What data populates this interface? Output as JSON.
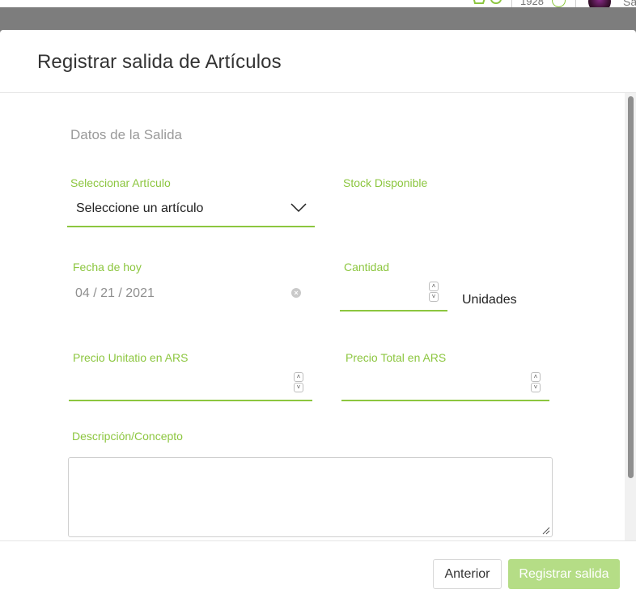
{
  "topbar": {
    "points": "1928",
    "user_name_partial": "Sa",
    "icons": [
      "cart-icon",
      "notification-icon",
      "coin-icon",
      "avatar"
    ]
  },
  "modal": {
    "title": "Registrar salida de Artículos",
    "section_title": "Datos de la Salida",
    "fields": {
      "article": {
        "label": "Seleccionar Artículo",
        "value": "Seleccione un artículo"
      },
      "stock": {
        "label": "Stock Disponible",
        "value": ""
      },
      "date": {
        "label": "Fecha de hoy",
        "value": "04 / 21 / 2021"
      },
      "quantity": {
        "label": "Cantidad",
        "value": "",
        "unit": "Unidades"
      },
      "unit_price": {
        "label": "Precio Unitatio en ARS",
        "value": ""
      },
      "total_price": {
        "label": "Precio Total en ARS",
        "value": ""
      },
      "description": {
        "label": "Descripción/Concepto",
        "value": ""
      }
    },
    "footer": {
      "prev_label": "Anterior",
      "submit_label": "Registrar salida"
    }
  },
  "colors": {
    "accent": "#8cc63f",
    "submit_disabled": "#b5dd86",
    "overlay": "#7d7d7d"
  }
}
